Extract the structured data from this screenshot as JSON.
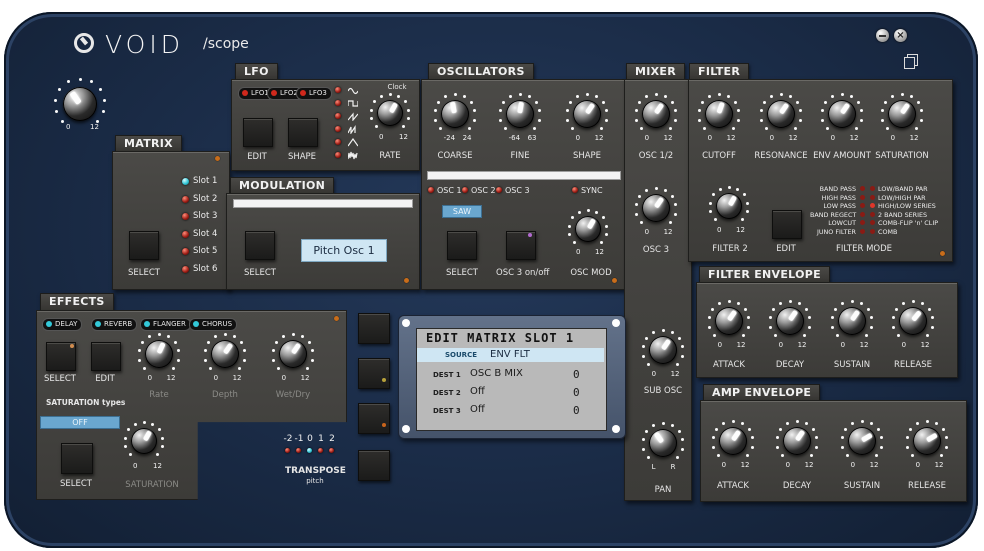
{
  "app": {
    "brand": "VOID",
    "product": "/scope"
  },
  "window_controls": {
    "minimize": "minimize-icon",
    "close": "close-icon",
    "copy": "copy-icon"
  },
  "colors": {
    "chassis": "#1a2b46",
    "panel": "#43423f",
    "display": "#cfe6f3",
    "led_red": "#b3231a",
    "led_cyan": "#33c8d8"
  },
  "master": {
    "min": "0",
    "max": "12"
  },
  "matrix": {
    "title": "MATRIX",
    "slots": [
      "Slot 1",
      "Slot 2",
      "Slot 3",
      "Slot 4",
      "Slot 5",
      "Slot 6"
    ],
    "select": "SELECT"
  },
  "lfo": {
    "title": "LFO",
    "chips": [
      "LFO1",
      "LFO2",
      "LFO3"
    ],
    "clock": "Clock",
    "edit": "EDIT",
    "shape": "SHAPE",
    "rate": "RATE",
    "min": "0",
    "max": "12"
  },
  "modulation": {
    "title": "MODULATION",
    "select": "SELECT",
    "destination": "Pitch Osc 1"
  },
  "oscillators": {
    "title": "OSCILLATORS",
    "knobs": [
      {
        "label": "COARSE",
        "min": "-24",
        "max": "24"
      },
      {
        "label": "FINE",
        "min": "-64",
        "max": "63"
      },
      {
        "label": "SHAPE",
        "min": "0",
        "max": "12"
      }
    ],
    "osc_buttons": [
      "OSC 1",
      "OSC 2",
      "OSC 3"
    ],
    "sync": "SYNC",
    "wave": "SAW",
    "select": "SELECT",
    "osc3_onoff": "OSC 3 on/off",
    "osc_mod": "OSC MOD",
    "osc_mod_min": "0",
    "osc_mod_max": "12"
  },
  "mixer": {
    "title": "MIXER",
    "knobs": [
      {
        "label": "OSC 1/2",
        "min": "0",
        "max": "12"
      },
      {
        "label": "OSC 3",
        "min": "0",
        "max": "12"
      },
      {
        "label": "SUB OSC",
        "min": "0",
        "max": "12"
      },
      {
        "label": "PAN",
        "min": "L",
        "max": "R"
      }
    ]
  },
  "filter": {
    "title": "FILTER",
    "knobs": [
      {
        "label": "CUTOFF",
        "min": "0",
        "max": "12"
      },
      {
        "label": "RESONANCE",
        "min": "0",
        "max": "12"
      },
      {
        "label": "ENV AMOUNT",
        "min": "0",
        "max": "12"
      },
      {
        "label": "SATURATION",
        "min": "0",
        "max": "12"
      }
    ],
    "filter2": {
      "label": "FILTER 2",
      "min": "0",
      "max": "12"
    },
    "edit": "EDIT",
    "mode_label": "FILTER MODE",
    "modes_left": [
      "BAND PASS",
      "HIGH PASS",
      "LOW PASS",
      "BAND REGECT",
      "LOWCUT",
      "JUNO FILTER"
    ],
    "modes_right": [
      "LOW/BAND PAR",
      "LOW/HIGH PAR",
      "HIGH/LOW SERIES",
      "2 BAND SERIES",
      "COMB-FLIP 'n' CLIP",
      "COMB"
    ]
  },
  "filter_envelope": {
    "title": "FILTER ENVELOPE",
    "knobs": [
      {
        "label": "ATTACK",
        "min": "0",
        "max": "12"
      },
      {
        "label": "DECAY",
        "min": "0",
        "max": "12"
      },
      {
        "label": "SUSTAIN",
        "min": "0",
        "max": "12"
      },
      {
        "label": "RELEASE",
        "min": "0",
        "max": "12"
      }
    ]
  },
  "amp_envelope": {
    "title": "AMP ENVELOPE",
    "knobs": [
      {
        "label": "ATTACK",
        "min": "0",
        "max": "12"
      },
      {
        "label": "DECAY",
        "min": "0",
        "max": "12"
      },
      {
        "label": "SUSTAIN",
        "min": "0",
        "max": "12"
      },
      {
        "label": "RELEASE",
        "min": "0",
        "max": "12"
      }
    ]
  },
  "effects": {
    "title": "EFFECTS",
    "chips": [
      "DELAY",
      "REVERB",
      "FLANGER",
      "CHORUS"
    ],
    "select": "SELECT",
    "edit": "EDIT",
    "knobs": [
      {
        "label": "Rate",
        "min": "0",
        "max": "12"
      },
      {
        "label": "Depth",
        "min": "0",
        "max": "12"
      },
      {
        "label": "Wet/Dry",
        "min": "0",
        "max": "12"
      }
    ],
    "saturation_types": "SATURATION types",
    "saturation_value": "OFF",
    "select2": "SELECT",
    "saturation": {
      "label": "SATURATION",
      "min": "0",
      "max": "12"
    }
  },
  "transpose": {
    "title": "TRANSPOSE",
    "sub": "pitch",
    "values": [
      "-2",
      "-1",
      "0",
      "1",
      "2"
    ],
    "active_index": 2
  },
  "edit_matrix": {
    "title": "EDIT MATRIX SLOT 1",
    "source_label": "SOURCE",
    "source": "ENV FLT",
    "dests": [
      {
        "label": "DEST 1",
        "value": "OSC B MIX",
        "amount": "0"
      },
      {
        "label": "DEST 2",
        "value": "Off",
        "amount": "0"
      },
      {
        "label": "DEST 3",
        "value": "Off",
        "amount": "0"
      }
    ]
  }
}
